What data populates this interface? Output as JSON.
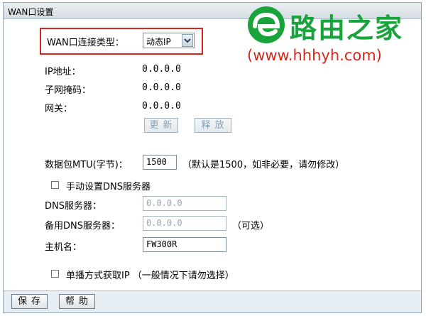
{
  "window": {
    "title": "WAN口设置"
  },
  "brand": {
    "name": "路由之家",
    "url": "(www.hhhyh.com)",
    "logo_color": "#19a33b",
    "url_color": "#d3281c"
  },
  "wan_type": {
    "label": "WAN口连接类型：",
    "selected": "动态IP"
  },
  "status": {
    "ip_label": "IP地址：",
    "ip_value": "0.0.0.0",
    "mask_label": "子网掩码：",
    "mask_value": "0.0.0.0",
    "gateway_label": "网关：",
    "gateway_value": "0.0.0.0"
  },
  "actions": {
    "renew": "更新",
    "release": "释放"
  },
  "mtu": {
    "label": "数据包MTU(字节)：",
    "value": "1500",
    "hint": "（默认是1500，如非必要，请勿修改）"
  },
  "dns": {
    "manual_label": "手动设置DNS服务器",
    "primary_label": "DNS服务器：",
    "primary_value": "0.0.0.0",
    "secondary_label": "备用DNS服务器：",
    "secondary_value": "0.0.0.0",
    "optional_hint": "（可选）"
  },
  "host": {
    "label": "主机名：",
    "value": "FW300R"
  },
  "unicast": {
    "label": "单播方式获取IP （一般情况下请勿选择）"
  },
  "footer": {
    "save": "保存",
    "help": "帮助"
  },
  "colors": {
    "highlight": "#d9231f",
    "frame": "#8fa7b7"
  }
}
